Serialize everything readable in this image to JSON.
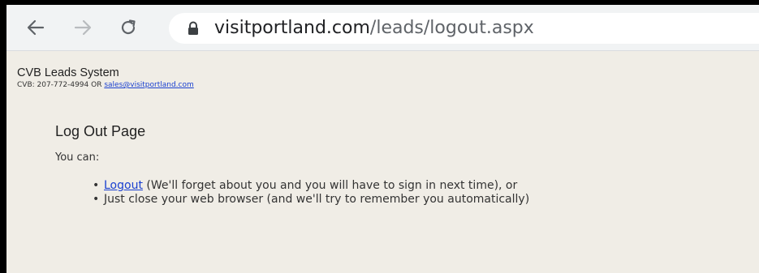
{
  "browser": {
    "url_host": "visitportland.com",
    "url_path": "/leads/logout.aspx",
    "icons": {
      "back": "back-arrow-icon",
      "forward": "forward-arrow-icon",
      "reload": "reload-icon",
      "secure": "lock-icon"
    }
  },
  "header": {
    "system_title": "CVB Leads System",
    "contact_prefix": "CVB: 207-772-4994 OR ",
    "contact_email": "sales@visitportland.com"
  },
  "main": {
    "title": "Log Out Page",
    "intro": "You can:",
    "options": [
      {
        "link_text": "Logout",
        "text": " (We'll forget about you and you will have to sign in next time), or"
      },
      {
        "text": "Just close your web browser (and we'll try to remember you automatically)"
      }
    ]
  },
  "colors": {
    "page_background": "#f0ede6",
    "link": "#1a40d0",
    "toolbar": "#f1f3f4"
  }
}
